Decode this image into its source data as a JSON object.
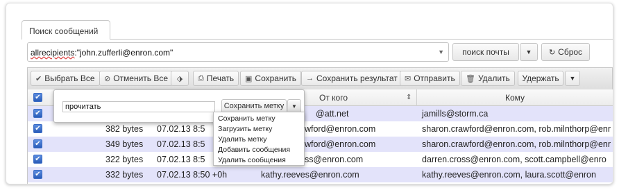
{
  "tab": {
    "label": "Поиск сообщений"
  },
  "search": {
    "query_prefix": "allrecipients",
    "query_suffix": ":\"john.zufferli@enron.com\""
  },
  "buttons": {
    "find": "поиск почты",
    "reset": "Сброс"
  },
  "toolbar": {
    "select_all": "Выбрать Все",
    "deselect_all": "Отменить Все",
    "print": "Печать",
    "save": "Сохранить",
    "save_result": "Сохранить результат",
    "send": "Отправить",
    "delete": "Удалить",
    "hold": "Удержать"
  },
  "columns": {
    "from": "От кого",
    "to": "Кому"
  },
  "rows": [
    {
      "size": "",
      "date": "",
      "from": "@att.net",
      "to": "jamills@storm.ca"
    },
    {
      "size": "382 bytes",
      "date": "07.02.13 8:5",
      "from": "awford@enron.com",
      "to": "sharon.crawford@enron.com, rob.milnthorp@enr"
    },
    {
      "size": "349 bytes",
      "date": "07.02.13 8:5",
      "from": "awford@enron.com",
      "to": "sharon.crawford@enron.com, rob.milnthorp@enr"
    },
    {
      "size": "322 bytes",
      "date": "07.02.13 8:5",
      "from": "oss@enron.com",
      "to": "darren.cross@enron.com, scott.campbell@enro"
    },
    {
      "size": "332 bytes",
      "date": "07.02.13 8:50 +0h",
      "from": "kathy.reeves@enron.com",
      "to": "kathy.reeves@enron.com, laura.scott@enron"
    }
  ],
  "label_popup": {
    "input_value": "прочитать",
    "save_button": "Сохранить метку",
    "menu": [
      "Сохранить метку",
      "Загрузить метку",
      "Удалить метку",
      "Добавить сообщения",
      "Удалить сообщения"
    ]
  }
}
